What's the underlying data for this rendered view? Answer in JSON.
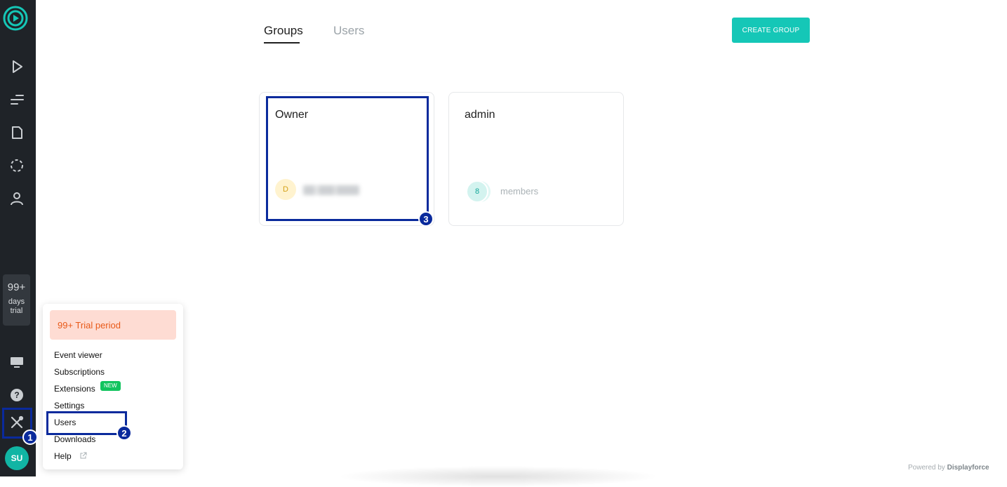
{
  "sidebar": {
    "trial_days": "99+",
    "trial_label_1": "days",
    "trial_label_2": "trial",
    "avatar_initials": "SU",
    "icons": [
      "logo-icon",
      "play-icon",
      "list-icon",
      "document-icon",
      "selection-icon",
      "user-icon",
      "monitor-icon",
      "help-icon",
      "tools-icon"
    ]
  },
  "tabs": {
    "groups": "Groups",
    "users": "Users"
  },
  "create_button": "CREATE GROUP",
  "groups": [
    {
      "name": "Owner",
      "member_initial": "D"
    },
    {
      "name": "admin",
      "member_count": "8",
      "members_label": "members"
    }
  ],
  "menu": {
    "trial_banner": "99+ Trial period",
    "items": [
      "Event viewer",
      "Subscriptions",
      "Extensions",
      "Settings",
      "Users",
      "Downloads",
      "Help"
    ],
    "new_badge": "NEW"
  },
  "annotations": [
    "1",
    "2",
    "3"
  ],
  "footer": {
    "powered_by": "Powered by",
    "brand": "Displayforce"
  },
  "colors": {
    "accent": "#15c7b7",
    "sidebar_bg": "#1f2328",
    "annotation": "#0a2a9c",
    "trial_banner_bg": "#fedcd3",
    "trial_banner_text": "#e85a19",
    "new_badge": "#12c45e"
  }
}
